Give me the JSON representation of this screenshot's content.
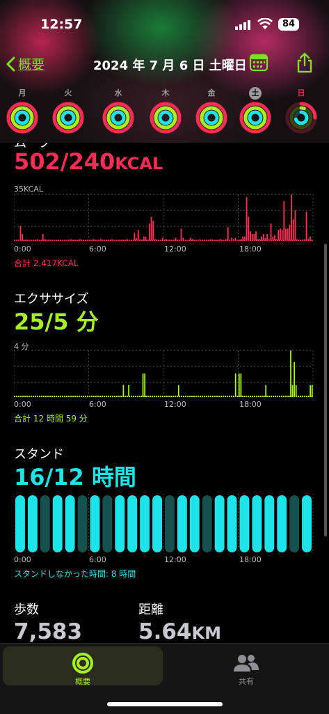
{
  "status_bar": {
    "time": "12:57",
    "battery": "84"
  },
  "nav": {
    "back_label": "概要",
    "title": "2024 年 7 月 6 日 土曜日"
  },
  "week": {
    "days": [
      "月",
      "火",
      "水",
      "木",
      "金",
      "土",
      "日"
    ],
    "selected_index": 5,
    "ring_colors": {
      "move": "#ff2d55",
      "exercise": "#a6f21c",
      "stand": "#1ee3e8"
    }
  },
  "move": {
    "title": "ムーブ",
    "value": "502/240",
    "unit": "KCAL",
    "color": "#ff2d55",
    "ymax_label": "35KCAL",
    "total": "合計 2,417KCAL",
    "x_ticks": [
      "0:00",
      "6:00",
      "12:00",
      "18:00"
    ]
  },
  "exercise": {
    "title": "エクササイズ",
    "value": "25/5 分",
    "color": "#a6f21c",
    "ymax_label": "4 分",
    "total": "合計 12 時間 59 分",
    "x_ticks": [
      "0:00",
      "6:00",
      "12:00",
      "18:00"
    ]
  },
  "stand": {
    "title": "スタンド",
    "value": "16/12 時間",
    "color": "#1ee3e8",
    "not_stand": "スタンドしなかった時間: 8 時間",
    "x_ticks": [
      "0:00",
      "6:00",
      "12:00",
      "18:00"
    ]
  },
  "stats": {
    "steps_label": "歩数",
    "steps_value": "7,583",
    "distance_label": "距離",
    "distance_value": "5.64",
    "distance_unit": "KM"
  },
  "tabs": {
    "summary": "概要",
    "sharing": "共有"
  },
  "chart_data": [
    {
      "type": "bar",
      "title": "ムーブ",
      "ylabel": "35KCAL",
      "xlabel": "",
      "x_ticks": [
        "0:00",
        "6:00",
        "12:00",
        "18:00"
      ],
      "ylim": [
        0,
        35
      ],
      "x_minutes_step": 20,
      "values": [
        0,
        0,
        0,
        11,
        5,
        0,
        0,
        0,
        0,
        0,
        0,
        0,
        1,
        0,
        0,
        5,
        1,
        0,
        0,
        0,
        0,
        0,
        0,
        0,
        0,
        0,
        0,
        0,
        0,
        0,
        1,
        0,
        0,
        0,
        0,
        1,
        0,
        0,
        0,
        0,
        0,
        0,
        1,
        0,
        0,
        0,
        1,
        0,
        0,
        0,
        0,
        0,
        1,
        0,
        0,
        0,
        0,
        0,
        0,
        0,
        1,
        0,
        0,
        0,
        6,
        2,
        8,
        1,
        0,
        3,
        3,
        0,
        13,
        18,
        15,
        1,
        0,
        0,
        0,
        2,
        0,
        1,
        0,
        0,
        0,
        0,
        2,
        0,
        0,
        9,
        2,
        0,
        0,
        0,
        2,
        1,
        0,
        0,
        0,
        1,
        0,
        0,
        0,
        0,
        0,
        1,
        0,
        0,
        0,
        0,
        1,
        0,
        0,
        1,
        10,
        0,
        2,
        1,
        2,
        0,
        0,
        1,
        3,
        3,
        33,
        18,
        7,
        5,
        5,
        7,
        1,
        1,
        3,
        5,
        2,
        5,
        1,
        13,
        3,
        4,
        1,
        8,
        9,
        8,
        30,
        9,
        9,
        12,
        35,
        16,
        23,
        1,
        0,
        0,
        0,
        1,
        22,
        1,
        3,
        0
      ],
      "color": "#ff2d55"
    },
    {
      "type": "bar",
      "title": "エクササイズ",
      "ylabel": "4 分",
      "xlabel": "",
      "x_ticks": [
        "0:00",
        "6:00",
        "12:00",
        "18:00"
      ],
      "ylim": [
        0,
        4
      ],
      "x_minutes_step": 20,
      "values": [
        0,
        0,
        0,
        0,
        0,
        0,
        0,
        0,
        0,
        0,
        0,
        0,
        0,
        0,
        0,
        0,
        0,
        0,
        0,
        0,
        0,
        0,
        0,
        0,
        0,
        0,
        0,
        0,
        0,
        0,
        0,
        0,
        0,
        0,
        0,
        0,
        0,
        0,
        0,
        0,
        0,
        0,
        0,
        0,
        0,
        0,
        0,
        0,
        0,
        0,
        0,
        0,
        0,
        0,
        0,
        0,
        0,
        0,
        0,
        0,
        0,
        1,
        0,
        0,
        1,
        0,
        0,
        0,
        0,
        0,
        0,
        0,
        2,
        2,
        0,
        0,
        0,
        0,
        0,
        0,
        0,
        0,
        0,
        0,
        0,
        0,
        0,
        0,
        0,
        0,
        0,
        0,
        1,
        0,
        0,
        0,
        0,
        0,
        0,
        0,
        0,
        0,
        0,
        0,
        0,
        0,
        0,
        0,
        0,
        0,
        0,
        0,
        0,
        0,
        0,
        0,
        0,
        0,
        0,
        0,
        0,
        0,
        0,
        0,
        2,
        0,
        2,
        2,
        0,
        0,
        0,
        0,
        0,
        0,
        0,
        0,
        0,
        0,
        0,
        0,
        0,
        1,
        0,
        0,
        0,
        0,
        0,
        0,
        0,
        0,
        0,
        0,
        0,
        0,
        0,
        4,
        1,
        3,
        1,
        0,
        0,
        0,
        0,
        0,
        0,
        0,
        1,
        1
      ],
      "color": "#a6f21c"
    },
    {
      "type": "bar",
      "title": "スタンド",
      "xlabel": "",
      "x_ticks": [
        "0:00",
        "6:00",
        "12:00",
        "18:00"
      ],
      "categories": [
        "0",
        "1",
        "2",
        "3",
        "4",
        "5",
        "6",
        "7",
        "8",
        "9",
        "10",
        "11",
        "12",
        "13",
        "14",
        "15",
        "16",
        "17",
        "18",
        "19",
        "20",
        "21",
        "22",
        "23"
      ],
      "values": [
        1,
        1,
        0,
        1,
        1,
        0,
        1,
        0,
        1,
        1,
        1,
        1,
        0,
        1,
        1,
        0,
        1,
        1,
        1,
        1,
        1,
        1,
        0,
        1
      ],
      "color": "#1ee3e8"
    }
  ]
}
